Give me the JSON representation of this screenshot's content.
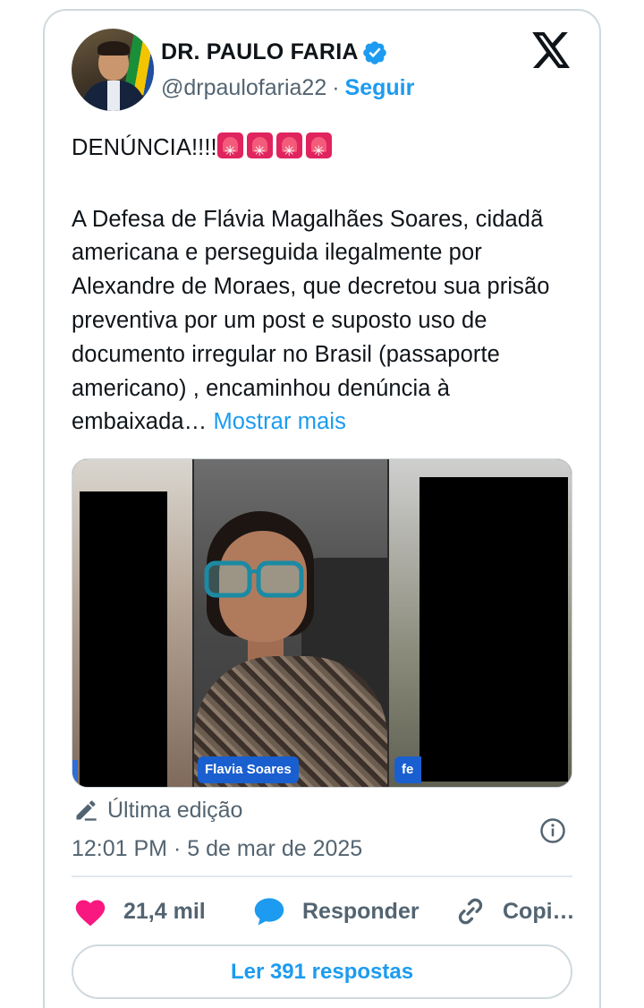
{
  "author": {
    "name": "DR. PAULO FARIA",
    "handle": "@drpaulofaria22",
    "separator": "·",
    "follow_label": "Seguir"
  },
  "tweet": {
    "headline": "DENÚNCIA!!!!",
    "siren_emoji_count": 4,
    "body": "A Defesa de Flávia Magalhães Soares, cidadã americana e perseguida ilegalmente por Alexandre de Moraes, que decretou sua prisão preventiva por um post e suposto uso de documento irregular no Brasil (passaporte americano) , encaminhou denúncia à embaixada…",
    "show_more": "Mostrar mais"
  },
  "media": {
    "caption_main": "Flavia Soares",
    "caption_right": "fe"
  },
  "meta": {
    "edit_label": "Última edição",
    "timestamp": "12:01 PM · 5 de mar de 2025"
  },
  "actions": {
    "likes": "21,4 mil",
    "reply_label": "Responder",
    "copy_label": "Copi…"
  },
  "replies_button": "Ler 391 respostas",
  "colors": {
    "accent": "#1d9bf0",
    "like": "#f91880",
    "text": "#0f1419",
    "muted": "#536471",
    "border": "#cfd9de"
  },
  "icons": {
    "verified": "verified-badge-icon",
    "brand": "x-logo-icon",
    "edit": "pencil-icon",
    "info": "info-icon",
    "like": "heart-icon",
    "reply": "speech-bubble-icon",
    "copy": "link-icon",
    "siren": "siren-emoji-icon"
  }
}
